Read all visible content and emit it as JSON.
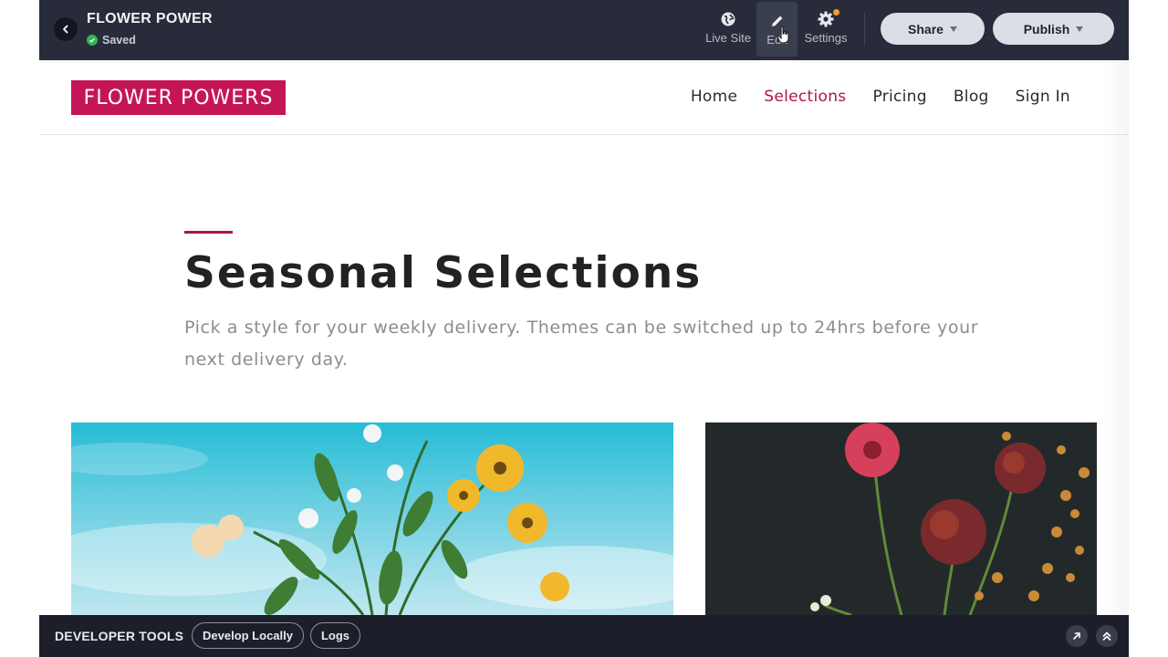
{
  "app": {
    "site_name": "FLOWER POWER",
    "save_status": "Saved"
  },
  "toolbar": {
    "live_site_label": "Live Site",
    "edit_label": "Edit",
    "settings_label": "Settings",
    "share_label": "Share",
    "publish_label": "Publish",
    "icons": {
      "back": "chevron-left-icon",
      "live_site": "globe-icon",
      "edit": "pencil-icon",
      "settings": "gear-icon"
    }
  },
  "site": {
    "logo_text": "FLOWER POWERS",
    "brand_color": "#c41656",
    "nav": [
      {
        "label": "Home",
        "active": false
      },
      {
        "label": "Selections",
        "active": true
      },
      {
        "label": "Pricing",
        "active": false
      },
      {
        "label": "Blog",
        "active": false
      },
      {
        "label": "Sign In",
        "active": false
      }
    ],
    "hero": {
      "title": "Seasonal Selections",
      "subtitle": "Pick a style for your weekly delivery. Themes can be switched up to 24hrs before your next delivery day."
    }
  },
  "dev_tools": {
    "title": "DEVELOPER TOOLS",
    "develop_locally_label": "Develop Locally",
    "logs_label": "Logs"
  }
}
